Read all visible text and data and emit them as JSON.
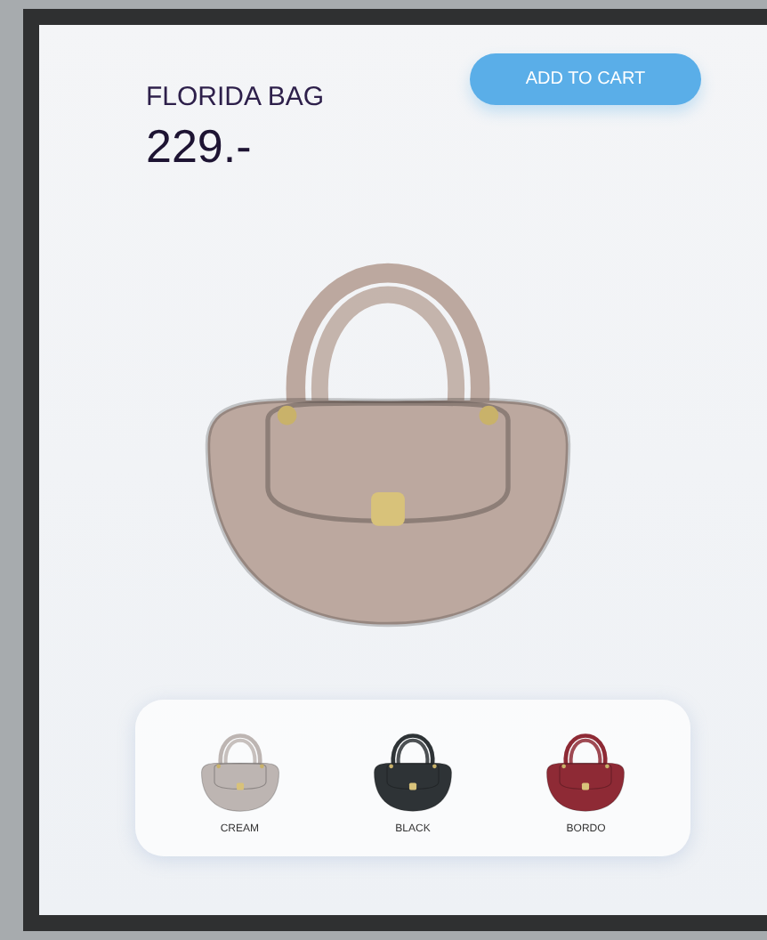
{
  "product": {
    "name": "FLORIDA BAG",
    "price": "229.-",
    "color": "#bca89f"
  },
  "add_to_cart": {
    "label": "ADD TO CART"
  },
  "variants": [
    {
      "label": "CREAM",
      "color": "#bdb5b2"
    },
    {
      "label": "BLACK",
      "color": "#2e3336"
    },
    {
      "label": "BORDO",
      "color": "#8e2a35"
    }
  ]
}
